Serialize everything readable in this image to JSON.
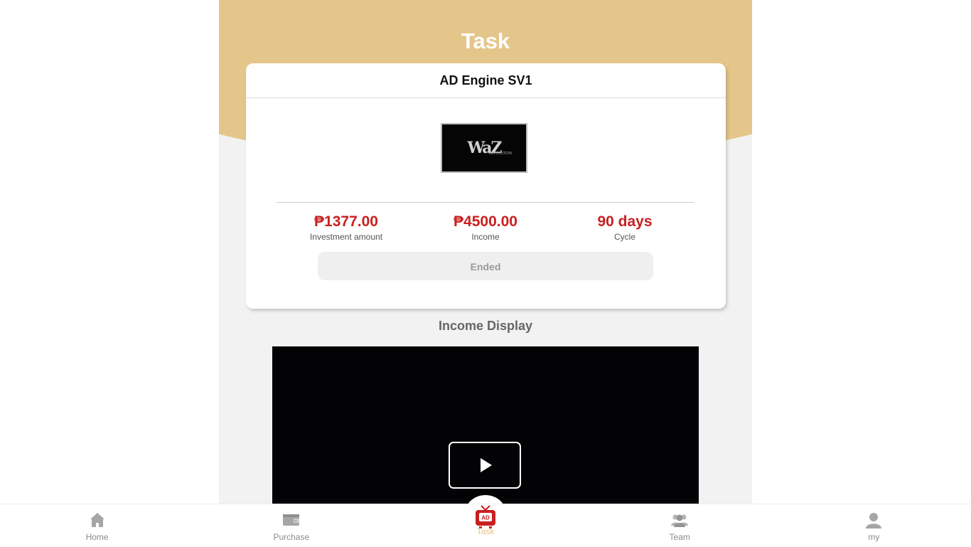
{
  "header": {
    "title": "Task"
  },
  "product": {
    "name": "AD Engine SV1",
    "image_text": "WaZ",
    "image_subtext": "REVOLUTION",
    "investment_amount": "₱1377.00",
    "investment_label": "Investment amount",
    "income": "₱4500.00",
    "income_label": "Income",
    "cycle": "90 days",
    "cycle_label": "Cycle",
    "status_button": "Ended"
  },
  "income_display": {
    "title": "Income Display"
  },
  "tabbar": {
    "items": [
      {
        "label": "Home",
        "icon": "home-icon"
      },
      {
        "label": "Purchase",
        "icon": "wallet-icon"
      },
      {
        "label": "Task",
        "icon": "ad-tv-icon",
        "active": true
      },
      {
        "label": "Team",
        "icon": "team-icon"
      },
      {
        "label": "my",
        "icon": "user-icon"
      }
    ]
  },
  "colors": {
    "header": "#e5c68a",
    "accent_red": "#c8201f",
    "active_tab": "#e5c68a"
  }
}
